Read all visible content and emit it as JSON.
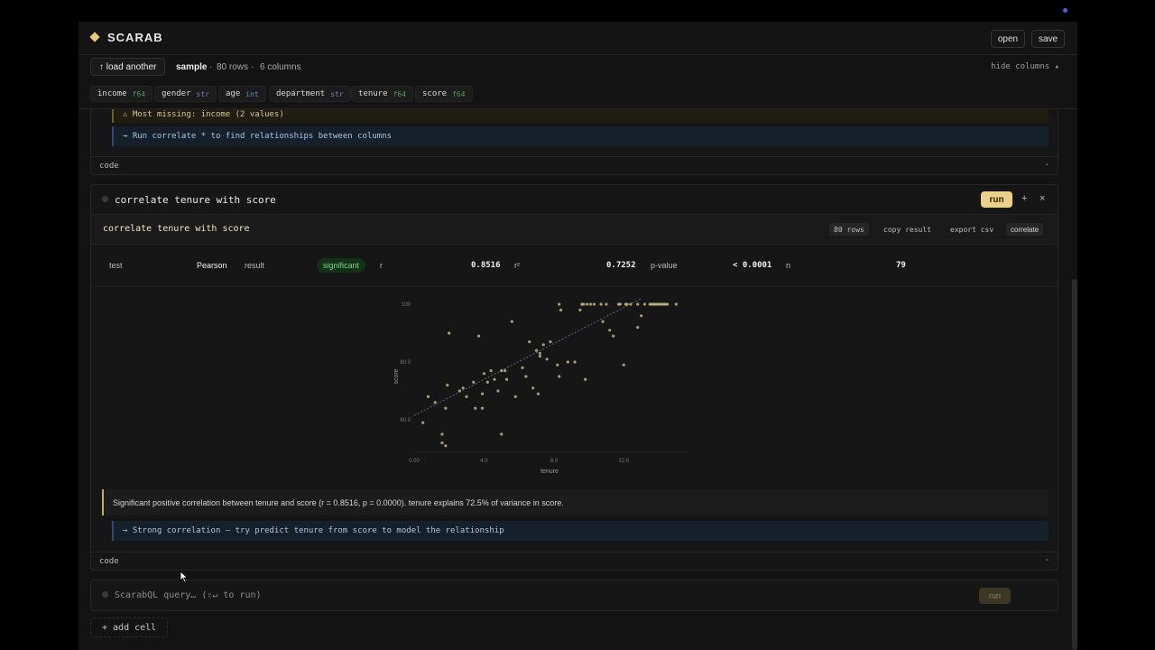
{
  "app": {
    "name": "SCARAB"
  },
  "topbar": {
    "open_label": "open",
    "save_label": "save"
  },
  "dataset": {
    "load_label": "↑  load another",
    "name": "sample",
    "rows": "80 rows",
    "cols": "6 columns",
    "hide_columns": "hide columns ▴"
  },
  "columns": [
    {
      "name": "income",
      "type": "f64",
      "type_color": "#4f9a5e"
    },
    {
      "name": "gender",
      "type": "str",
      "type_color": "#7b7bd0"
    },
    {
      "name": "age",
      "type": "int",
      "type_color": "#5f8fc6"
    },
    {
      "name": "department",
      "type": "str",
      "type_color": "#7b7bd0"
    },
    {
      "name": "tenure",
      "type": "f64",
      "type_color": "#4f9a5e"
    },
    {
      "name": "score",
      "type": "f64",
      "type_color": "#4f9a5e"
    }
  ],
  "prev_cell": {
    "warning": "⚠ Most missing: income (2 values)",
    "hint": "→ Run correlate * to find relationships between columns",
    "code_label": "code",
    "code_toggle": "-"
  },
  "corr_cell": {
    "title": "correlate tenure with score",
    "run_label": "run",
    "add_icon": "+",
    "close_icon": "×",
    "result_title": "correlate tenure with score",
    "rows_badge": "80 rows",
    "copy_label": "copy result",
    "export_label": "export csv",
    "kind_label": "correlate",
    "stats": {
      "test_label": "test",
      "test_value": "Pearson",
      "result_label": "result",
      "result_value": "significant",
      "r_label": "r",
      "r_value": "0.8516",
      "r2_label": "r²",
      "r2_value": "0.7252",
      "p_label": "p-value",
      "p_value": "< 0.0001",
      "n_label": "n",
      "n_value": "79"
    },
    "summary": "Significant positive correlation between tenure and score (r = 0.8516, p = 0.0000). tenure explains 72.5% of variance in score.",
    "hint": "→ Strong correlation — try predict tenure from score to model the relationship",
    "code_label": "code",
    "code_toggle": "-"
  },
  "query_cell": {
    "placeholder": "ScarabQL query… (⇧↵ to run)",
    "run_label": "run"
  },
  "add_cell_label": "+ add cell",
  "chart_data": {
    "type": "scatter",
    "xlabel": "tenure",
    "ylabel": "score",
    "xlim": [
      0,
      15.5
    ],
    "ylim": [
      50,
      100
    ],
    "x_ticks": [
      "0.00",
      "4.0",
      "8.0",
      "12.0"
    ],
    "x_tick_values": [
      0,
      4,
      8,
      12
    ],
    "y_ticks": [
      "100",
      "80.0",
      "60.0"
    ],
    "y_tick_values": [
      100,
      80,
      60
    ],
    "point_color": "#d8c98a",
    "trend_color": "#8d84c8",
    "trend": {
      "x0": 0,
      "y0": 61.5,
      "x1": 13,
      "y1": 102
    },
    "points": [
      [
        0.5,
        59
      ],
      [
        0.8,
        68
      ],
      [
        1.2,
        66
      ],
      [
        1.6,
        55
      ],
      [
        1.6,
        52
      ],
      [
        1.8,
        51
      ],
      [
        1.8,
        64
      ],
      [
        1.9,
        72
      ],
      [
        2,
        90
      ],
      [
        2.6,
        70
      ],
      [
        2.8,
        71
      ],
      [
        3.0,
        68
      ],
      [
        3.4,
        73
      ],
      [
        3.5,
        64
      ],
      [
        3.7,
        89
      ],
      [
        3.9,
        64
      ],
      [
        3.9,
        69
      ],
      [
        4.0,
        76
      ],
      [
        4.2,
        73
      ],
      [
        4.4,
        77
      ],
      [
        4.6,
        74
      ],
      [
        4.8,
        70
      ],
      [
        5.0,
        77
      ],
      [
        5.0,
        55
      ],
      [
        5.2,
        77
      ],
      [
        5.3,
        74
      ],
      [
        5.6,
        94
      ],
      [
        5.8,
        68
      ],
      [
        6.2,
        78
      ],
      [
        6.4,
        75
      ],
      [
        6.6,
        87
      ],
      [
        6.8,
        71
      ],
      [
        7.0,
        84
      ],
      [
        7.1,
        69
      ],
      [
        7.2,
        82
      ],
      [
        7.2,
        83
      ],
      [
        7.4,
        86
      ],
      [
        7.6,
        81
      ],
      [
        7.8,
        87
      ],
      [
        8.2,
        79
      ],
      [
        8.3,
        75
      ],
      [
        8.3,
        100
      ],
      [
        8.4,
        98
      ],
      [
        8.8,
        80
      ],
      [
        9.2,
        80
      ],
      [
        9.5,
        98
      ],
      [
        9.6,
        100
      ],
      [
        9.7,
        100
      ],
      [
        9.8,
        74
      ],
      [
        9.9,
        100
      ],
      [
        10.1,
        100
      ],
      [
        10.3,
        100
      ],
      [
        10.7,
        100
      ],
      [
        10.8,
        94
      ],
      [
        11.0,
        100
      ],
      [
        11.2,
        91
      ],
      [
        11.4,
        89
      ],
      [
        11.7,
        100
      ],
      [
        11.8,
        100
      ],
      [
        12.1,
        100
      ],
      [
        12.2,
        100
      ],
      [
        12.4,
        100
      ],
      [
        12.8,
        100
      ],
      [
        12.8,
        92
      ],
      [
        13.0,
        96
      ],
      [
        13.2,
        100
      ],
      [
        13.5,
        100
      ],
      [
        13.6,
        100
      ],
      [
        13.7,
        100
      ],
      [
        13.8,
        100
      ],
      [
        13.9,
        100
      ],
      [
        14.0,
        100
      ],
      [
        14.1,
        100
      ],
      [
        14.2,
        100
      ],
      [
        14.3,
        100
      ],
      [
        14.4,
        100
      ],
      [
        14.5,
        100
      ],
      [
        15.0,
        100
      ],
      [
        12.0,
        79
      ]
    ]
  }
}
